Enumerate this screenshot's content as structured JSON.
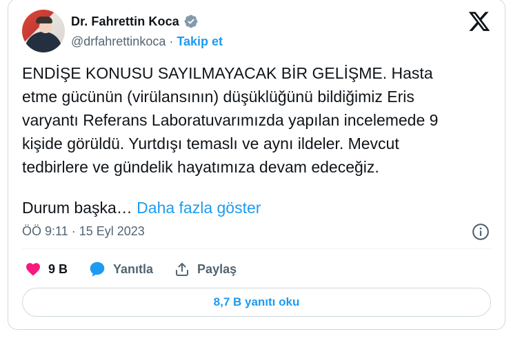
{
  "author": {
    "name": "Dr. Fahrettin Koca",
    "handle": "@drfahrettinkoca",
    "separator": " · ",
    "follow_label": "Takip et"
  },
  "tweet": {
    "text": "ENDİŞE KONUSU SAYILMAYACAK BİR GELİŞME. Hasta\netme gücünün (virülansının) düşüklüğünü bildiğimiz Eris\nvaryantı Referans Laboratuvarımızda yapılan incelemede 9\nkişide görüldü. Yurtdışı temaslı ve aynı ildeler. Mevcut\ntedbirlere ve gündelik hayatımıza devam edeceğiz.",
    "truncated_text": "Durum başka… ",
    "show_more_label": "Daha fazla göster",
    "timestamp": "ÖÖ 9:11 · 15 Eyl 2023"
  },
  "actions": {
    "likes": "9 B",
    "reply_label": "Yanıtla",
    "share_label": "Paylaş"
  },
  "replies_button_label": "8,7 B yanıtı oku",
  "colors": {
    "accent": "#1d9bf0",
    "like": "#f91880",
    "muted": "#536471",
    "border": "#cfd9de"
  },
  "icons": [
    "verified-badge-icon",
    "x-logo-icon",
    "info-icon",
    "heart-icon",
    "reply-bubble-icon",
    "share-icon"
  ]
}
